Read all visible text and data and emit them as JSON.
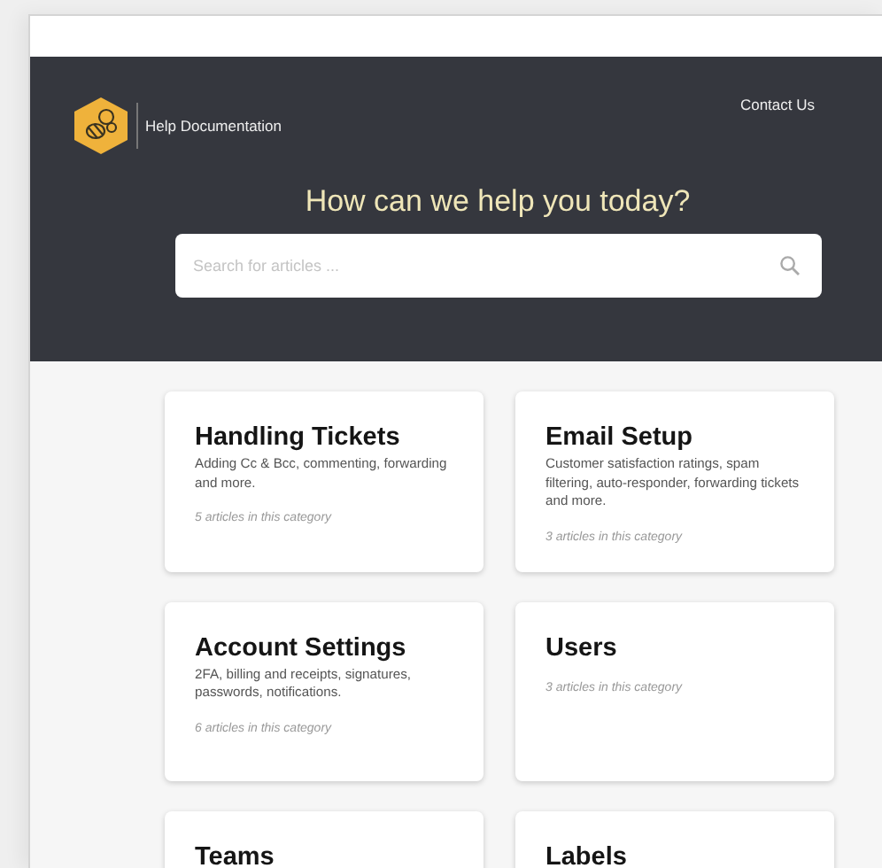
{
  "header": {
    "brand": "Help Documentation",
    "nav_link": "Contact Us",
    "heading": "How can we help you today?",
    "search": {
      "placeholder": "Search for articles ..."
    }
  },
  "categories": [
    {
      "title": "Handling Tickets",
      "description": "Adding Cc & Bcc, commenting, forwarding and more.",
      "count": "5 articles in this category"
    },
    {
      "title": "Email Setup",
      "description": "Customer satisfaction ratings, spam filtering, auto-responder, forwarding tickets and more.",
      "count": "3 articles in this category"
    },
    {
      "title": "Account Settings",
      "description": "2FA, billing and receipts, signatures, passwords, notifications.",
      "count": "6 articles in this category"
    },
    {
      "title": "Users",
      "count": "3 articles in this category"
    },
    {
      "title": "Teams"
    },
    {
      "title": "Labels"
    }
  ]
}
